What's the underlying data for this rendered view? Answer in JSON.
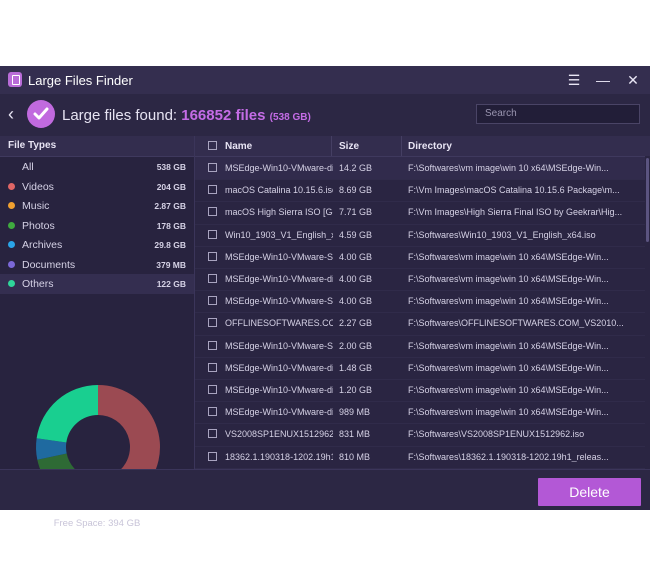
{
  "window": {
    "title": "Large Files Finder",
    "menu_icon": "hamburger-icon",
    "minimize_icon": "minimize-icon",
    "close_icon": "close-icon"
  },
  "header": {
    "label": "Large files found:",
    "count": "166852 files",
    "total_size": "(538 GB)"
  },
  "search": {
    "placeholder": "Search"
  },
  "sidebar": {
    "title": "File Types",
    "items": [
      {
        "label": "All",
        "size": "538 GB",
        "color": ""
      },
      {
        "label": "Videos",
        "size": "204 GB",
        "color": "#e06666"
      },
      {
        "label": "Music",
        "size": "2.87 GB",
        "color": "#f0a030"
      },
      {
        "label": "Photos",
        "size": "178 GB",
        "color": "#3faa3f"
      },
      {
        "label": "Archives",
        "size": "29.8 GB",
        "color": "#2aa4e8"
      },
      {
        "label": "Documents",
        "size": "379 MB",
        "color": "#7b68d8"
      },
      {
        "label": "Others",
        "size": "122 GB",
        "color": "#2fd69a"
      }
    ],
    "free_space": "Free Space: 394 GB"
  },
  "donut": {
    "segments": [
      {
        "name": "Videos",
        "value": 204,
        "color": "#9b4a52"
      },
      {
        "name": "Music",
        "value": 2.87,
        "color": "#8a6a2a"
      },
      {
        "name": "Photos",
        "value": 178,
        "color": "#2e6a35"
      },
      {
        "name": "Archives",
        "value": 29.8,
        "color": "#1f6aa0"
      },
      {
        "name": "Others",
        "value": 122,
        "color": "#19cf90"
      }
    ]
  },
  "table": {
    "columns": {
      "name": "Name",
      "size": "Size",
      "directory": "Directory"
    },
    "rows": [
      {
        "name": "MSEdge-Win10-VMware-di",
        "size": "14.2 GB",
        "dir": "F:\\Softwares\\vm image\\win 10 x64\\MSEdge-Win..."
      },
      {
        "name": "macOS Catalina 10.15.6.iso",
        "size": "8.69 GB",
        "dir": "F:\\Vm Images\\macOS Catalina 10.15.6 Package\\m..."
      },
      {
        "name": "macOS High Sierra ISO [Geek",
        "size": "7.71 GB",
        "dir": "F:\\Vm Images\\High Sierra Final ISO by Geekrar\\Hig..."
      },
      {
        "name": "Win10_1903_V1_English_x",
        "size": "4.59 GB",
        "dir": "F:\\Softwares\\Win10_1903_V1_English_x64.iso"
      },
      {
        "name": "MSEdge-Win10-VMware-Sr",
        "size": "4.00 GB",
        "dir": "F:\\Softwares\\vm image\\win 10 x64\\MSEdge-Win..."
      },
      {
        "name": "MSEdge-Win10-VMware-di",
        "size": "4.00 GB",
        "dir": "F:\\Softwares\\vm image\\win 10 x64\\MSEdge-Win..."
      },
      {
        "name": "MSEdge-Win10-VMware-Sr",
        "size": "4.00 GB",
        "dir": "F:\\Softwares\\vm image\\win 10 x64\\MSEdge-Win..."
      },
      {
        "name": "OFFLINESOFTWARES.COM_",
        "size": "2.27 GB",
        "dir": "F:\\Softwares\\OFFLINESOFTWARES.COM_VS2010..."
      },
      {
        "name": "MSEdge-Win10-VMware-Sr",
        "size": "2.00 GB",
        "dir": "F:\\Softwares\\vm image\\win 10 x64\\MSEdge-Win..."
      },
      {
        "name": "MSEdge-Win10-VMware-di",
        "size": "1.48 GB",
        "dir": "F:\\Softwares\\vm image\\win 10 x64\\MSEdge-Win..."
      },
      {
        "name": "MSEdge-Win10-VMware-di",
        "size": "1.20 GB",
        "dir": "F:\\Softwares\\vm image\\win 10 x64\\MSEdge-Win..."
      },
      {
        "name": "MSEdge-Win10-VMware-di",
        "size": "989 MB",
        "dir": "F:\\Softwares\\vm image\\win 10 x64\\MSEdge-Win..."
      },
      {
        "name": "VS2008SP1ENUX1512962.i",
        "size": "831 MB",
        "dir": "F:\\Softwares\\VS2008SP1ENUX1512962.iso"
      },
      {
        "name": "18362.1.190318-1202.19h1",
        "size": "810 MB",
        "dir": "F:\\Softwares\\18362.1.190318-1202.19h1_releas..."
      }
    ]
  },
  "footer": {
    "delete_label": "Delete"
  }
}
